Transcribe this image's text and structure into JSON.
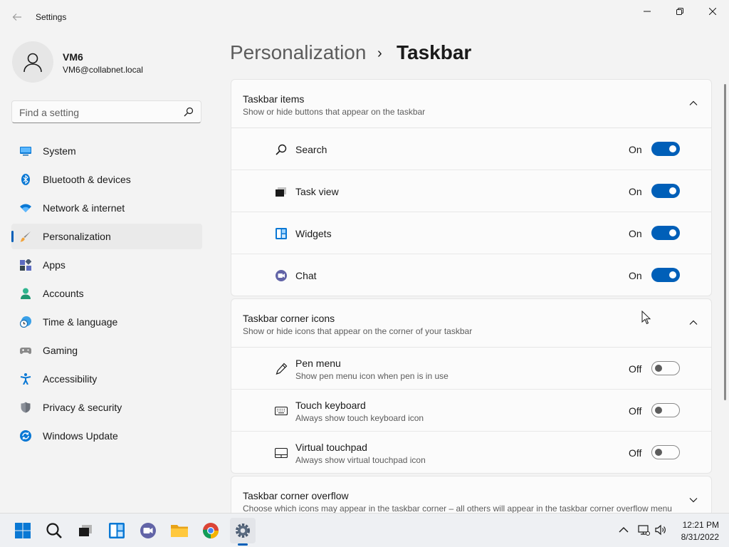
{
  "window": {
    "title": "Settings"
  },
  "user": {
    "name": "VM6",
    "email": "VM6@collabnet.local"
  },
  "search": {
    "placeholder": "Find a setting",
    "value": ""
  },
  "nav": {
    "items": [
      {
        "label": "System",
        "icon": "monitor-icon"
      },
      {
        "label": "Bluetooth & devices",
        "icon": "bluetooth-icon"
      },
      {
        "label": "Network & internet",
        "icon": "wifi-icon"
      },
      {
        "label": "Personalization",
        "icon": "paintbrush-icon",
        "selected": true
      },
      {
        "label": "Apps",
        "icon": "apps-icon"
      },
      {
        "label": "Accounts",
        "icon": "person-icon"
      },
      {
        "label": "Time & language",
        "icon": "clock-globe-icon"
      },
      {
        "label": "Gaming",
        "icon": "gamepad-icon"
      },
      {
        "label": "Accessibility",
        "icon": "accessibility-icon"
      },
      {
        "label": "Privacy & security",
        "icon": "shield-icon"
      },
      {
        "label": "Windows Update",
        "icon": "update-icon"
      }
    ]
  },
  "header": {
    "parent": "Personalization",
    "separator": "›",
    "current": "Taskbar"
  },
  "taskbar_items": {
    "title": "Taskbar items",
    "subtitle": "Show or hide buttons that appear on the taskbar",
    "expanded": true,
    "rows": [
      {
        "label": "Search",
        "state": "On",
        "on": true,
        "icon": "search-icon"
      },
      {
        "label": "Task view",
        "state": "On",
        "on": true,
        "icon": "task-view-icon"
      },
      {
        "label": "Widgets",
        "state": "On",
        "on": true,
        "icon": "widgets-icon"
      },
      {
        "label": "Chat",
        "state": "On",
        "on": true,
        "icon": "chat-icon"
      }
    ]
  },
  "corner_icons": {
    "title": "Taskbar corner icons",
    "subtitle": "Show or hide icons that appear on the corner of your taskbar",
    "expanded": true,
    "rows": [
      {
        "label": "Pen menu",
        "description": "Show pen menu icon when pen is in use",
        "state": "Off",
        "on": false,
        "icon": "pen-icon"
      },
      {
        "label": "Touch keyboard",
        "description": "Always show touch keyboard icon",
        "state": "Off",
        "on": false,
        "icon": "keyboard-icon"
      },
      {
        "label": "Virtual touchpad",
        "description": "Always show virtual touchpad icon",
        "state": "Off",
        "on": false,
        "icon": "touchpad-icon"
      }
    ]
  },
  "corner_overflow": {
    "title": "Taskbar corner overflow",
    "subtitle": "Choose which icons may appear in the taskbar corner – all others will appear in the taskbar corner overflow menu",
    "expanded": false
  },
  "taskbar": {
    "apps": [
      "start-icon",
      "search-icon",
      "task-view-icon",
      "widgets-icon",
      "teams-chat-icon",
      "file-explorer-icon",
      "chrome-icon",
      "settings-icon"
    ],
    "active_app": "settings-icon",
    "tray": [
      "chevron-up-icon",
      "network-icon",
      "volume-icon"
    ],
    "time": "12:21 PM",
    "date": "8/31/2022"
  },
  "colors": {
    "accent": "#005fb8",
    "background": "#f3f3f3",
    "card": "#fbfbfb"
  }
}
